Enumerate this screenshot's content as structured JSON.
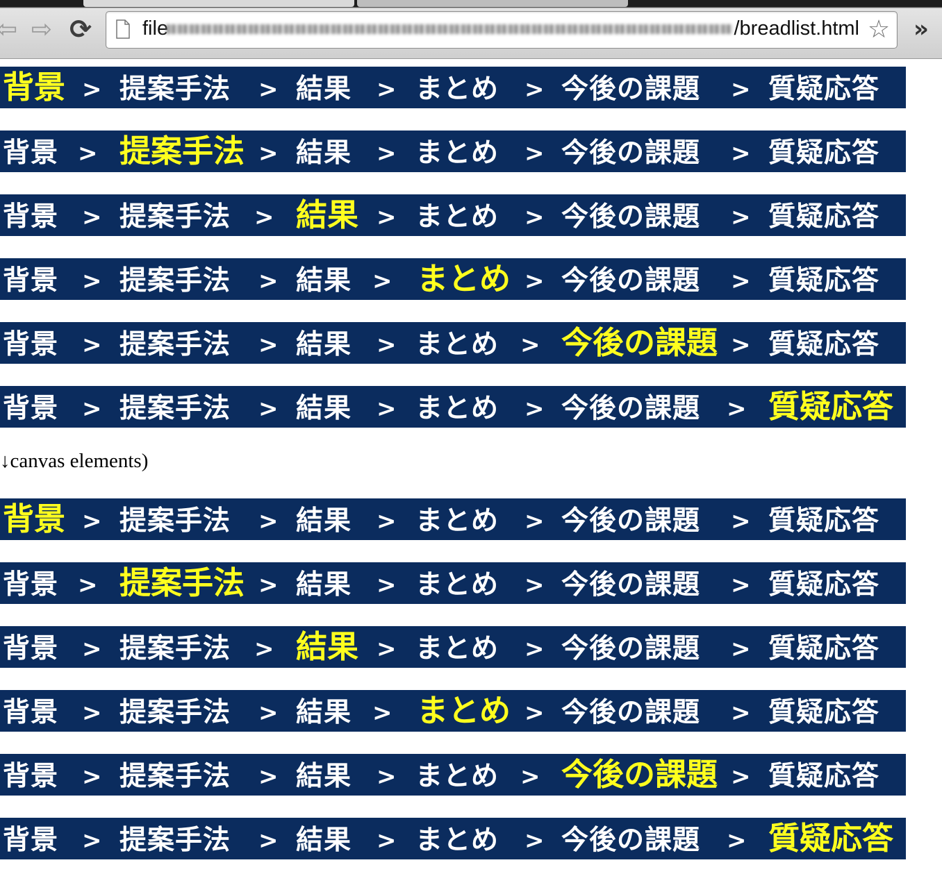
{
  "browser": {
    "url_prefix": "file",
    "url_suffix": "/breadlist.html",
    "back_label": "⇦",
    "forward_label": "⇨",
    "reload_label": "⟳",
    "star_label": "☆",
    "overflow_label": "»"
  },
  "breadcrumb": {
    "items": [
      "背景",
      "提案手法",
      "結果",
      "まとめ",
      "今後の課題",
      "質疑応答"
    ],
    "separator": ">"
  },
  "caption": "↓canvas elements)",
  "colors": {
    "bar_background": "#0b2c5e",
    "inactive_text": "#ffffff",
    "active_text": "#ffff1e"
  },
  "groups": [
    {
      "rows": [
        {
          "active_index": 0
        },
        {
          "active_index": 1
        },
        {
          "active_index": 2
        },
        {
          "active_index": 3
        },
        {
          "active_index": 4
        },
        {
          "active_index": 5
        }
      ]
    },
    {
      "rows": [
        {
          "active_index": 0
        },
        {
          "active_index": 1
        },
        {
          "active_index": 2
        },
        {
          "active_index": 3
        },
        {
          "active_index": 4
        },
        {
          "active_index": 5
        }
      ]
    }
  ]
}
